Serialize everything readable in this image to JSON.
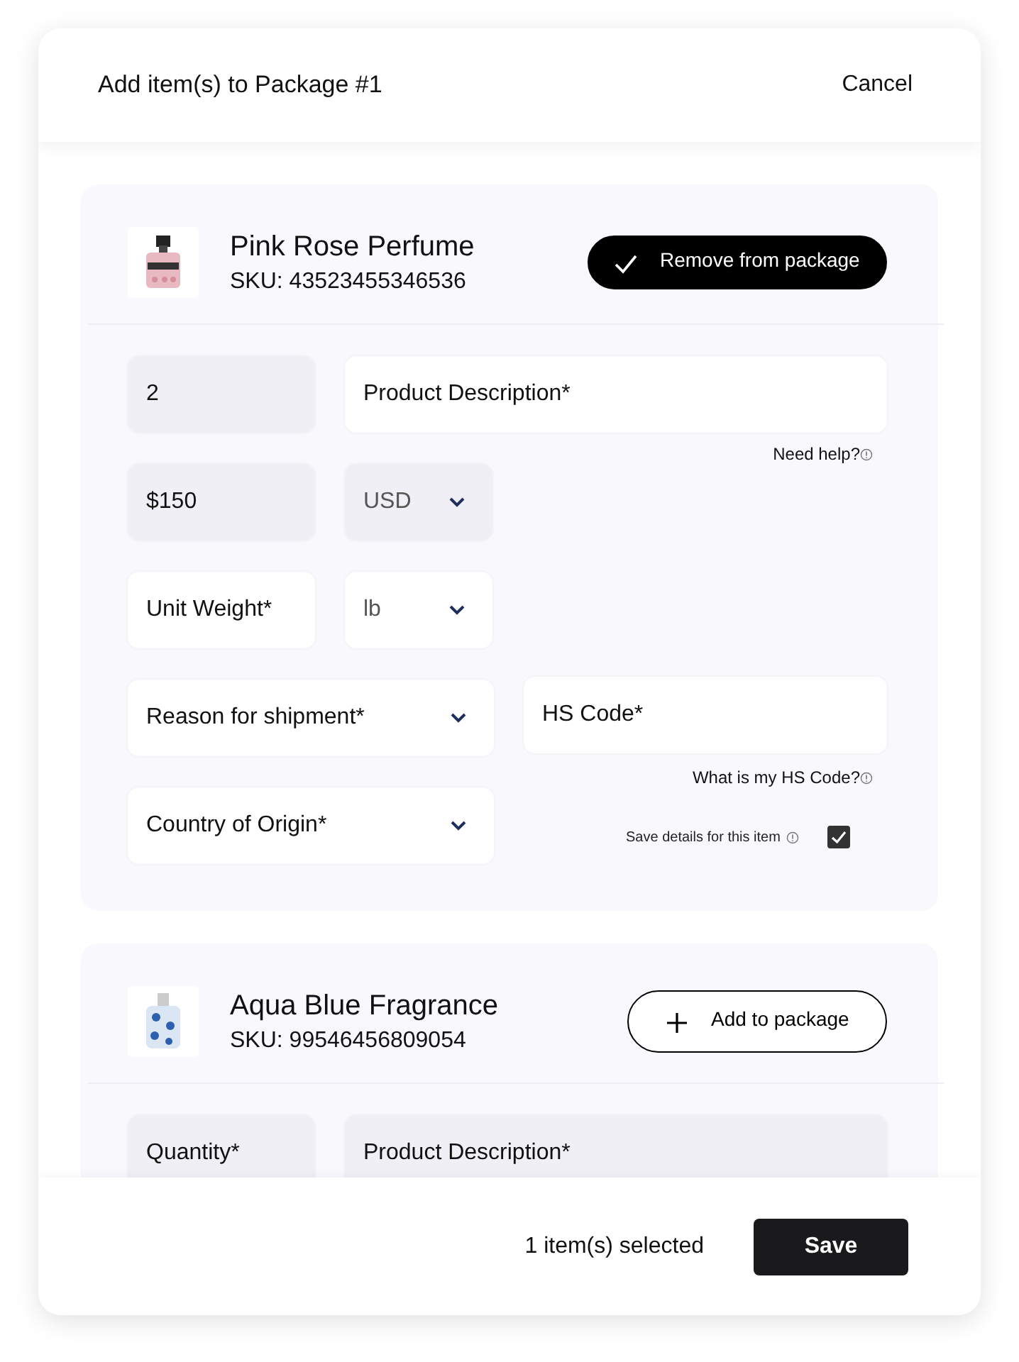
{
  "dialog": {
    "title": "Add item(s) to Package #1",
    "cancel": "Cancel"
  },
  "items": [
    {
      "name": "Pink Rose Perfume",
      "sku": "SKU: 43523455346536",
      "picture": {
        "kind": "picture"
      },
      "selected": true,
      "action": "Remove from package",
      "rows": [
        {
          "fields": [
            {
              "kind": "input",
              "value": "2",
              "disabled": true
            },
            {
              "kind": "input",
              "placeholder": "Product Description*",
              "disabled": false
            }
          ],
          "hint": "Need help?"
        },
        {
          "fields": [
            {
              "kind": "input",
              "value": "$150",
              "disabled": true
            },
            {
              "kind": "select",
              "value": "USD",
              "disabled": true
            }
          ]
        },
        {
          "fields": [
            {
              "kind": "input",
              "placeholder": "Unit Weight*",
              "disabled": false
            },
            {
              "kind": "select",
              "value": "lb",
              "disabled": false
            }
          ]
        },
        {
          "fields": [
            {
              "kind": "select",
              "placeholder": "Reason for shipment*",
              "disabled": false
            },
            {
              "kind": "input",
              "placeholder": "HS Code*",
              "disabled": false
            }
          ],
          "hint": "What is my HS Code?"
        },
        {
          "fields": [
            {
              "kind": "select",
              "placeholder": "Country of Origin*",
              "disabled": false
            },
            {
              "kind": "checkbox",
              "label": "Save details for this item",
              "checked": true
            }
          ]
        }
      ]
    },
    {
      "name": "Aqua Blue Fragrance",
      "sku": "SKU: 99546456809054",
      "picture": {
        "kind": "picture"
      },
      "selected": false,
      "action": "Add to package",
      "rows": [
        {
          "fields": [
            {
              "kind": "input",
              "placeholder": "Quantity*",
              "disabled": true
            },
            {
              "kind": "input",
              "placeholder": "Product Description*",
              "disabled": true
            }
          ]
        }
      ]
    }
  ],
  "footer": {
    "count": "1 item(s) selected",
    "save": "Save"
  }
}
